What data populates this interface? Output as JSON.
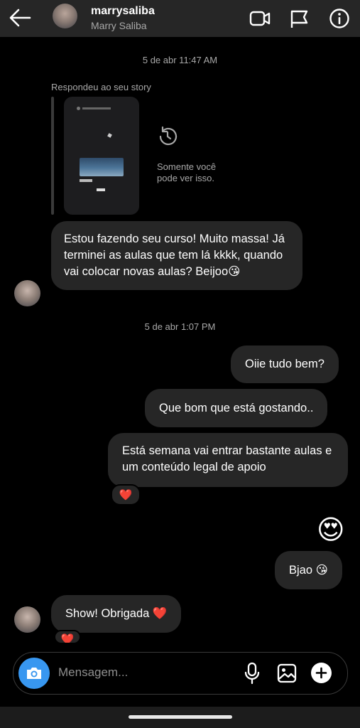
{
  "header": {
    "username": "marrysaliba",
    "full_name": "Marry Saliba",
    "icons": [
      "back-arrow-icon",
      "video-call-icon",
      "flag-icon",
      "info-icon"
    ]
  },
  "conversation": {
    "timestamp_1": "5 de abr 11:47 AM",
    "story_reply": {
      "label": "Respondeu ao seu story",
      "restricted_note_line1": "Somente você",
      "restricted_note_line2": "pode ver isso."
    },
    "messages": [
      {
        "side": "in",
        "text": "Estou fazendo seu curso! Muito massa! Já terminei as aulas que tem lá kkkk, quando vai colocar novas aulas? Beijoo😘"
      },
      {
        "side": "out",
        "text": "Oiie tudo bem?"
      },
      {
        "side": "out",
        "text": "Que bom que está gostando.."
      },
      {
        "side": "out",
        "text": "Está semana vai entrar bastante aulas e um conteúdo legal de apoio",
        "reaction": "❤️"
      },
      {
        "side": "out",
        "text": "😍"
      },
      {
        "side": "out",
        "text": "Bjao 😘"
      },
      {
        "side": "in",
        "text": "Show! Obrigada ❤️",
        "reaction": "❤️"
      }
    ],
    "timestamp_2": "5 de abr 1:07 PM"
  },
  "composer": {
    "placeholder": "Mensagem...",
    "icons": [
      "camera-icon",
      "microphone-icon",
      "gallery-icon",
      "add-icon"
    ]
  },
  "colors": {
    "background": "#000000",
    "bubble": "#262626",
    "header": "#262626",
    "camera_button": "#3897f0",
    "muted_text": "#a8a8a8"
  }
}
